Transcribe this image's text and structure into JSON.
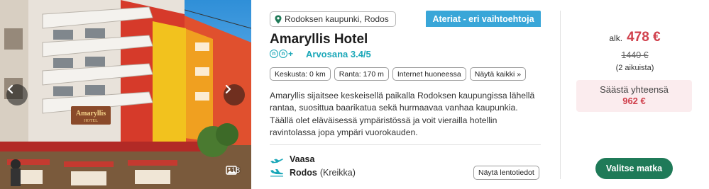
{
  "hotel": {
    "location": "Rodoksen kaupunki, Rodos",
    "board_badge": "Ateriat - eri vaihtoehtoja",
    "name": "Amaryllis Hotel",
    "category_plus": "+",
    "rating_text": "Arvosana 3.4/5",
    "description": "Amaryllis sijaitsee keskeisellä paikalla Rodoksen kaupungissa lähellä rantaa, suosittua baarikatua sekä hurmaavaa vanhaa kaupunkia. Täällä olet eläväisessä ympäristössä ja voit vierailla hotellin ravintolassa jopa ympäri vuorokauden.",
    "facts": [
      "Keskusta: 0 km",
      "Ranta: 170 m",
      "Internet huoneessa"
    ],
    "show_all_label": "Näytä kaikki »"
  },
  "photo": {
    "sign_text_1": "Amaryllis",
    "sign_text_2": "HOTEL",
    "image_count": "18"
  },
  "flights": {
    "outbound_city": "Vaasa",
    "inbound_city": "Rodos",
    "inbound_country": "(Kreikka)",
    "details_label": "Näytä lentotiedot"
  },
  "price": {
    "from_label": "alk.",
    "value": "478 €",
    "old_value": "1440 €",
    "travellers": "(2 aikuista)",
    "savings_label": "Säästä yhteensä",
    "savings_value": "962 €",
    "select_label": "Valitse matka"
  },
  "colors": {
    "accent_teal": "#1aa7b8",
    "badge_blue": "#39a6d8",
    "price_red": "#d0404c",
    "button_green": "#1f7a58",
    "savings_bg": "#fbecee"
  },
  "icons": {
    "prev": "chevron-left-icon",
    "next": "chevron-right-icon",
    "gallery": "image-icon",
    "location": "map-pin-icon",
    "outbound": "plane-takeoff-icon",
    "inbound": "plane-landing-icon"
  }
}
